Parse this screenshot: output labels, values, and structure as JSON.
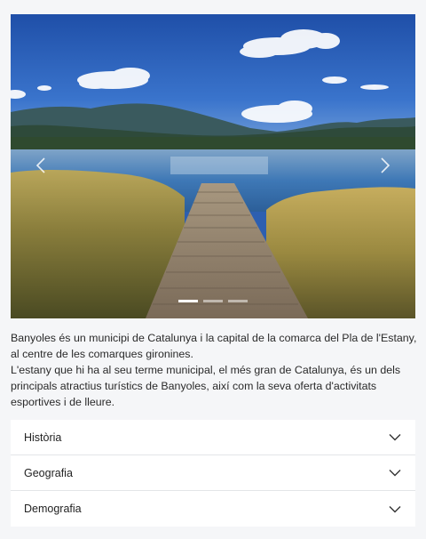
{
  "carousel": {
    "image_alt": "Estany de Banyoles amb embarcador de fusta",
    "slides_count": 3,
    "active_index": 0,
    "prev_icon": "chevron-left-icon",
    "next_icon": "chevron-right-icon"
  },
  "description": {
    "paragraph_1": "Banyoles és un municipi de Catalunya i la capital de la comarca del Pla de l'Estany, al centre de les comarques gironines.",
    "paragraph_2": "L'estany que hi ha al seu terme municipal, el més gran de Catalunya, és un dels principals atractius turístics de Banyoles, així com la seva oferta d'activitats esportives i de lleure."
  },
  "accordion": {
    "items": [
      {
        "label": "Història",
        "icon": "chevron-down-icon",
        "expanded": false
      },
      {
        "label": "Geografia",
        "icon": "chevron-down-icon",
        "expanded": false
      },
      {
        "label": "Demografia",
        "icon": "chevron-down-icon",
        "expanded": false
      }
    ]
  },
  "colors": {
    "page_background": "#f5f6f8",
    "panel_background": "#ffffff",
    "text": "#222222",
    "divider": "#e3e5e8"
  }
}
